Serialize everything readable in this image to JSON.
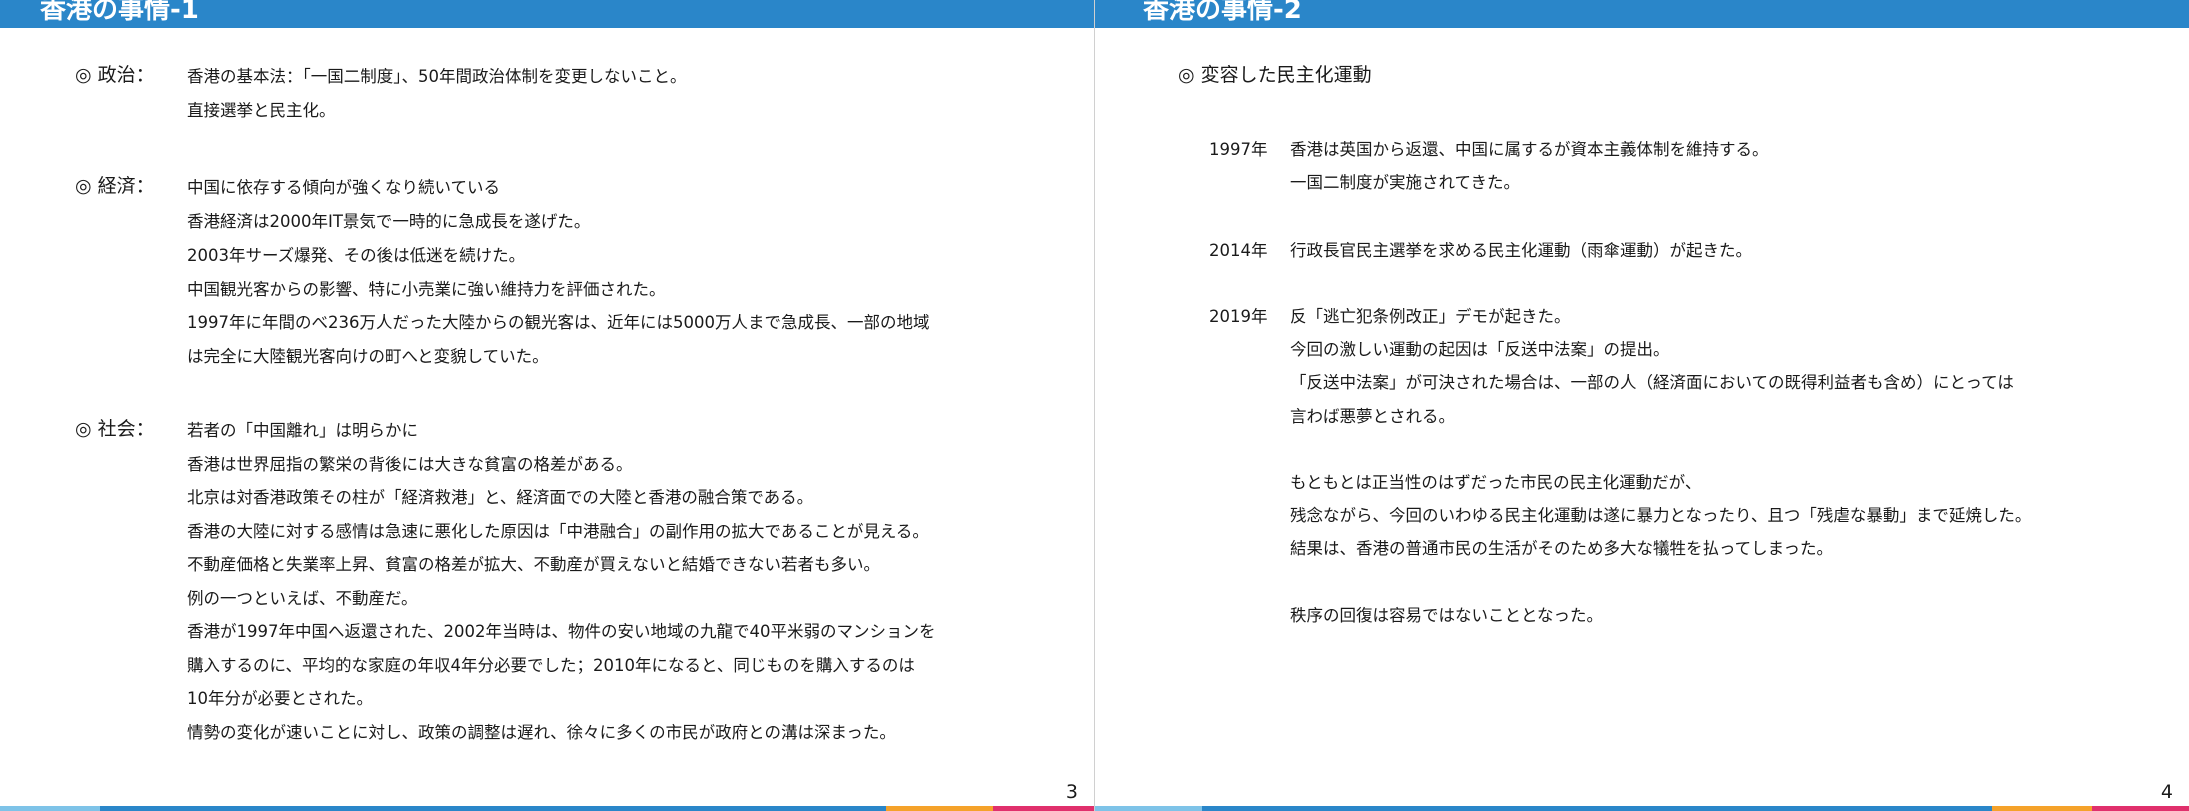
{
  "slide1": {
    "title": "香港の事情-1",
    "politics": {
      "label": "◎ 政治：",
      "lines": [
        "香港の基本法：「一国二制度」、50年間政治体制を変更しないこと。",
        "直接選挙と民主化。"
      ]
    },
    "economy": {
      "label": "◎ 経済：",
      "lines": [
        "中国に依存する傾向が強くなり続いている",
        "香港経済は2000年IT景気で一時的に急成長を遂げた。",
        "2003年サーズ爆発、その後は低迷を続けた。",
        "中国観光客からの影響、特に小売業に強い維持力を評価された。",
        "1997年に年間のべ236万人だった大陸からの観光客は、近年には5000万人まで急成長、一部の地域",
        "は完全に大陸観光客向けの町へと変貌していた。"
      ]
    },
    "society": {
      "label": "◎ 社会：",
      "lines": [
        "若者の「中国離れ」は明らかに",
        "香港は世界屈指の繁栄の背後には大きな貧富の格差がある。",
        "北京は対香港政策その柱が「経済救港」と、経済面での大陸と香港の融合策である。",
        "香港の大陸に対する感情は急速に悪化した原因は「中港融合」の副作用の拡大であることが見える。",
        "不動産価格と失業率上昇、貧富の格差が拡大、不動産が買えないと結婚できない若者も多い。",
        "例の一つといえば、不動産だ。",
        "香港が1997年中国へ返還された、2002年当時は、物件の安い地域の九龍で40平米弱のマンションを",
        "購入するのに、平均的な家庭の年収4年分必要でした；2010年になると、同じものを購入するのは",
        "10年分が必要とされた。",
        "情勢の変化が速いことに対し、政策の調整は遅れ、徐々に多くの市民が政府との溝は深まった。"
      ]
    },
    "page_number": "3"
  },
  "slide2": {
    "title": "香港の事情-2",
    "heading": "◎ 変容した民主化運動",
    "entries": [
      {
        "year": "1997年",
        "lines": [
          "香港は英国から返還、中国に属するが資本主義体制を維持する。",
          "一国二制度が実施されてきた。"
        ]
      },
      {
        "year": "2014年",
        "lines": [
          "行政長官民主選挙を求める民主化運動（雨傘運動）が起きた。"
        ]
      },
      {
        "year": "2019年",
        "lines": [
          "反「逃亡犯条例改正」デモが起きた。",
          "今回の激しい運動の起因は「反送中法案」の提出。",
          "「反送中法案」が可決された場合は、一部の人（経済面においての既得利益者も含め）にとっては",
          "言わば悪夢とされる。"
        ]
      }
    ],
    "paragraph2": [
      "もともとは正当性のはずだった市民の民主化運動だが、",
      "残念ながら、今回のいわゆる民主化運動は遂に暴力となったり、且つ「残虐な暴動」まで延焼した。",
      "結果は、香港の普通市民の生活がそのため多大な犠牲を払ってしまった。"
    ],
    "paragraph3": [
      "秩序の回復は容易ではないこととなった。"
    ],
    "page_number": "4"
  },
  "colors": {
    "header": "#2a86c9",
    "footer": [
      "#7ec3e8",
      "#2a86c9",
      "#f5a22a",
      "#e0306c"
    ]
  }
}
